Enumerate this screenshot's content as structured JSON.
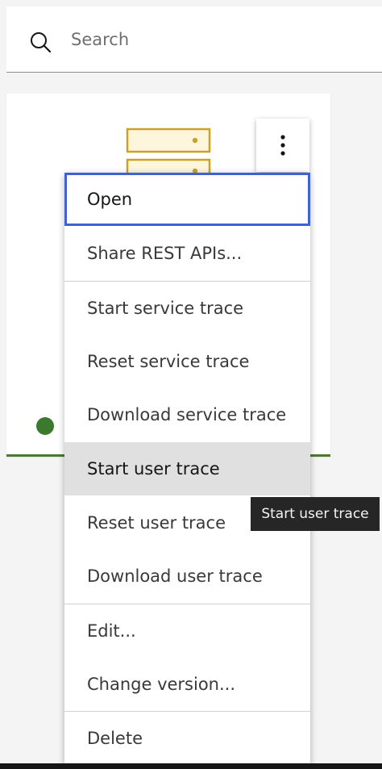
{
  "search": {
    "placeholder": "Search",
    "icon": "search-icon"
  },
  "tile": {
    "icon": "server-icon",
    "status_color": "#3c7a2d",
    "overflow_icon": "overflow-menu-vertical-icon"
  },
  "menu": {
    "items": [
      {
        "label": "Open",
        "state": "focused"
      },
      {
        "label": "Share REST APIs..."
      },
      {
        "label": "Start service trace"
      },
      {
        "label": "Reset service trace"
      },
      {
        "label": "Download service trace"
      },
      {
        "label": "Start user trace",
        "state": "hovered"
      },
      {
        "label": "Reset user trace"
      },
      {
        "label": "Download user trace"
      },
      {
        "label": "Edit..."
      },
      {
        "label": "Change version..."
      },
      {
        "label": "Delete"
      }
    ]
  },
  "tooltip": {
    "text": "Start user trace"
  },
  "colors": {
    "focus": "#4260d6",
    "hover": "#e0e0e0",
    "tooltip_bg": "#262626",
    "icon_yellow": "#c9a227"
  }
}
